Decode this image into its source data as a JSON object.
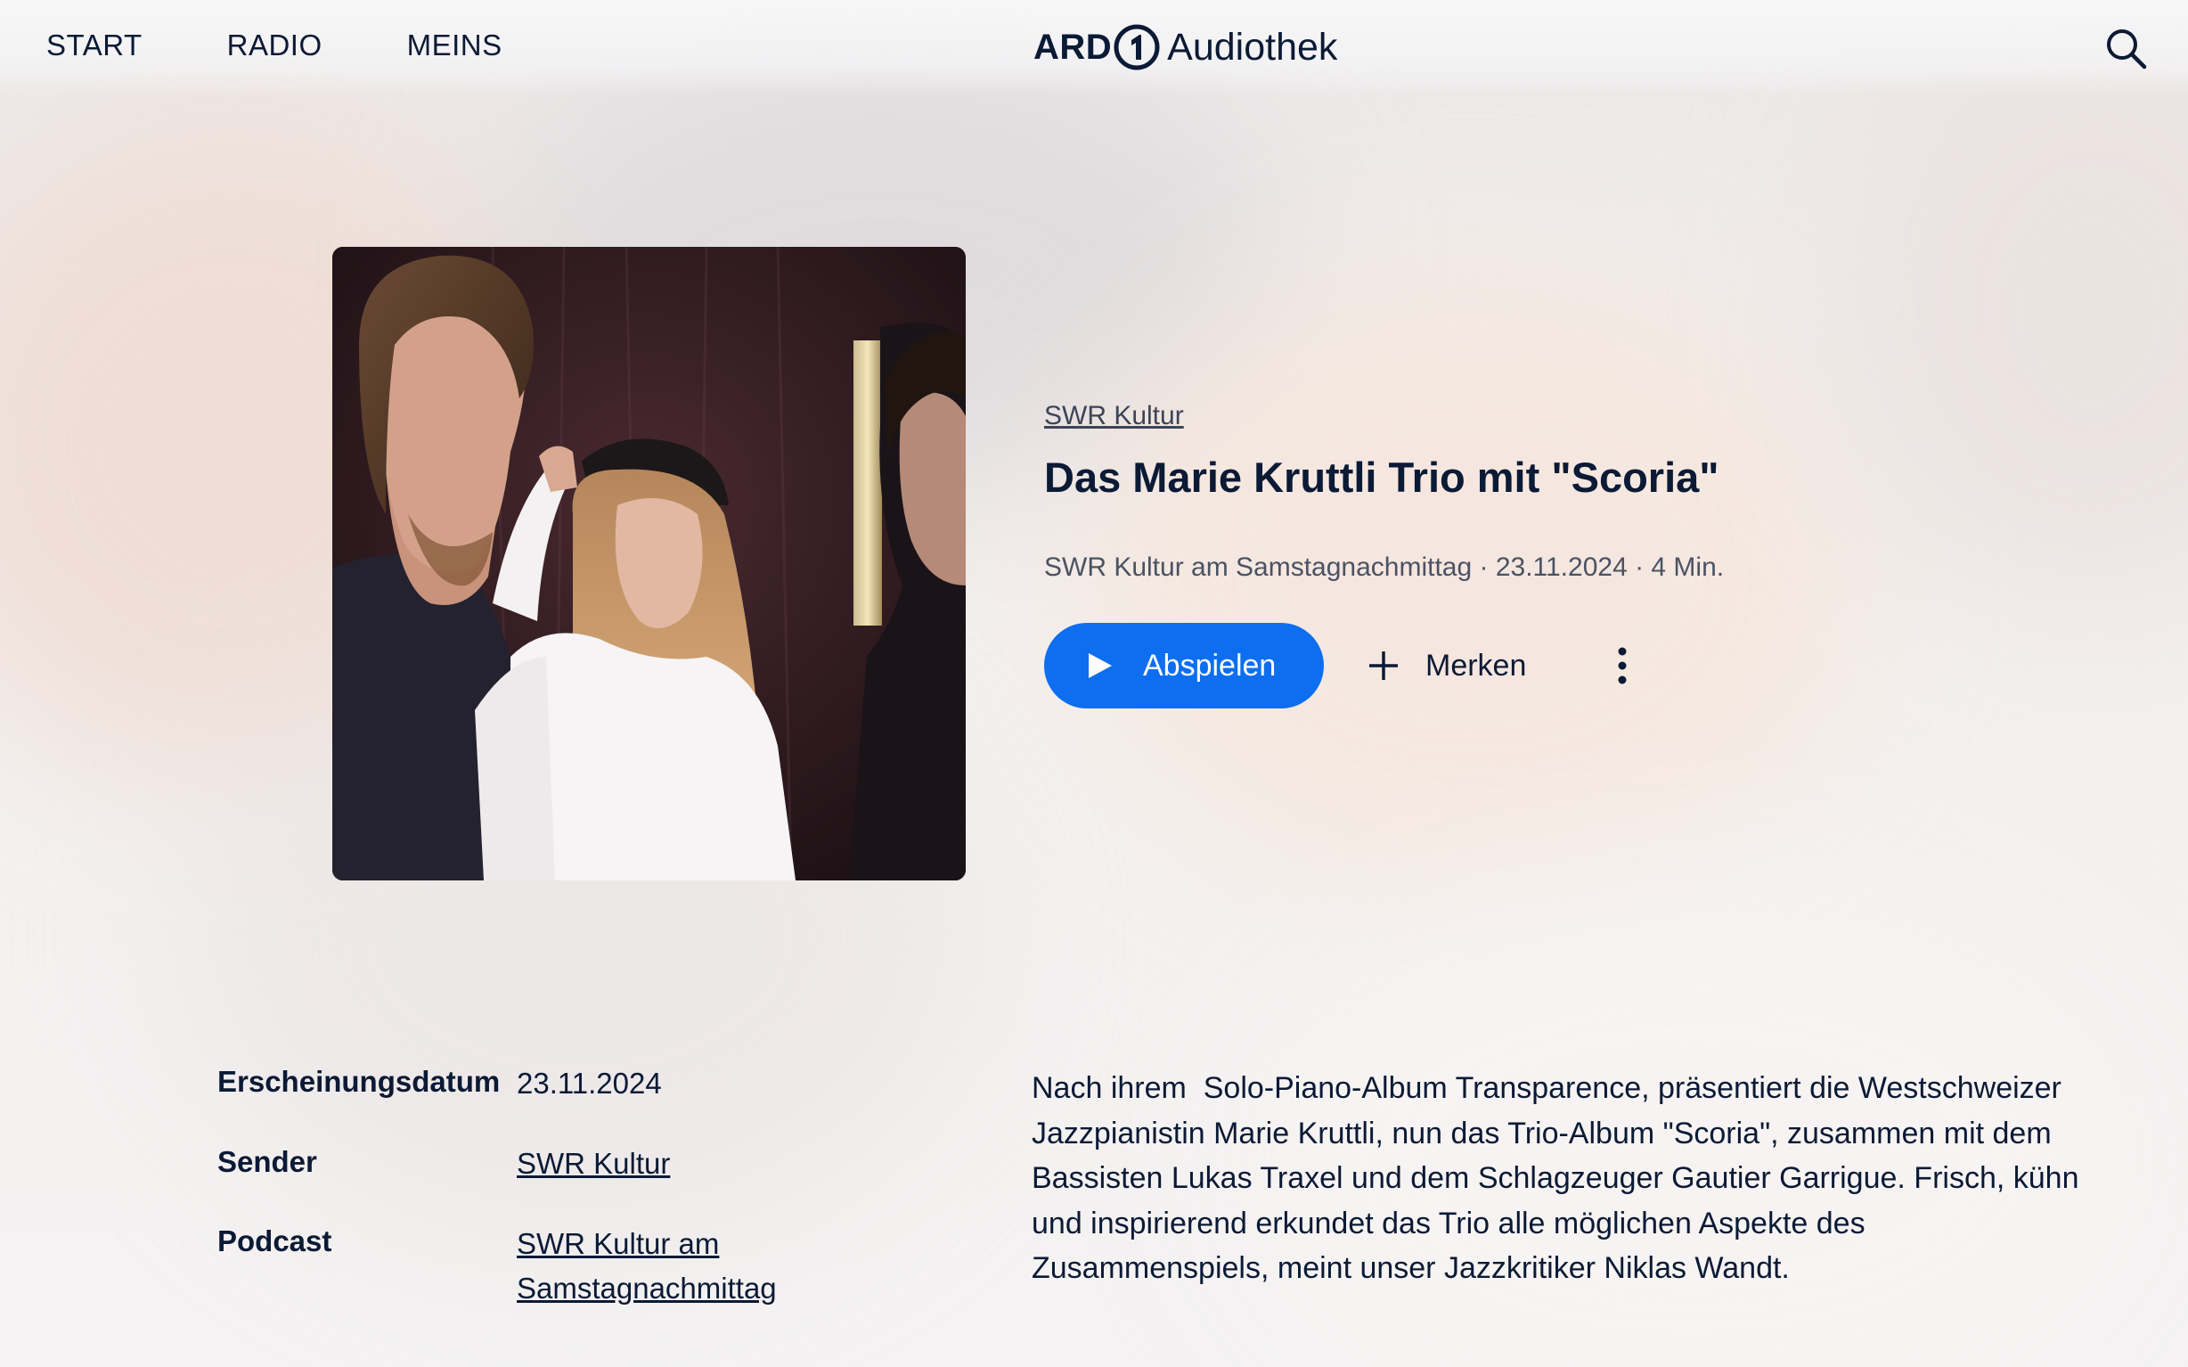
{
  "header": {
    "nav": [
      "START",
      "RADIO",
      "MEINS"
    ],
    "logo": {
      "brand": "ARD",
      "product": "Audiothek"
    },
    "search_icon": "search-icon"
  },
  "episode": {
    "channel": "SWR Kultur",
    "title": "Das Marie Kruttli Trio mit \"Scoria\"",
    "meta": "SWR Kultur am Samstagnachmittag · 23.11.2024 · 4 Min.",
    "play_label": "Abspielen",
    "bookmark_label": "Merken"
  },
  "details": [
    {
      "label": "Erscheinungsdatum",
      "value": "23.11.2024"
    },
    {
      "label": "Sender",
      "value": "SWR Kultur"
    },
    {
      "label": "Podcast",
      "value": "SWR Kultur am Samstagnachmittag"
    }
  ],
  "description": "Nach ihrem  Solo-Piano-Album Transparence, präsentiert die Westschweizer Jazzpianistin Marie Kruttli, nun das Trio-Album \"Scoria\", zusammen mit dem Bassisten Lukas Traxel und dem Schlagzeuger Gautier Garrigue. Frisch, kühn und inspirierend erkundet das Trio alle möglichen Aspekte des Zusammenspiels, meint unser Jazzkritiker Niklas Wandt.",
  "colors": {
    "accent": "#0d6ef0",
    "text": "#0b1a35"
  }
}
